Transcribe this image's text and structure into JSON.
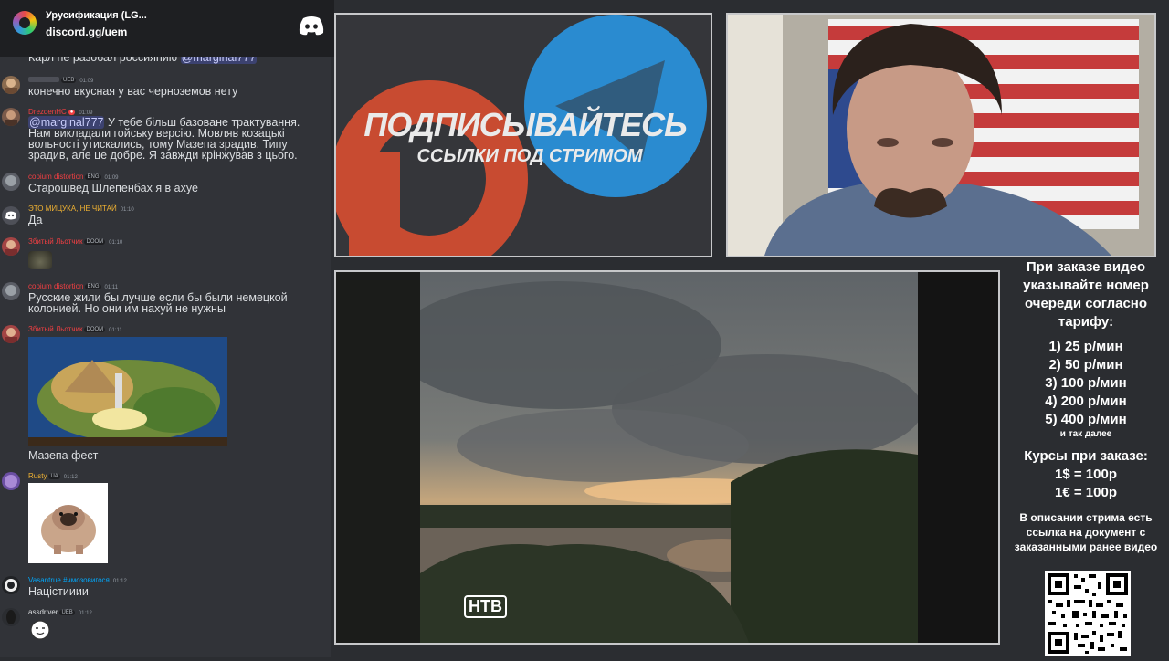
{
  "server": {
    "name": "Урусификация (LG...",
    "link": "discord.gg/uem",
    "logo_icon": "discord-icon"
  },
  "messages": [
    {
      "id": "m0",
      "username": "",
      "badges": [],
      "time": "",
      "text_parts": [
        {
          "t": "Карл не разобал россиянию "
        },
        {
          "t": "@marginal777",
          "mention": true
        }
      ],
      "name_color": "#949ba4"
    },
    {
      "id": "m1",
      "username": "",
      "badges": [
        "UEB"
      ],
      "time": "01:09",
      "text": "конечно вкусная  у вас черноземов нету",
      "name_color": "#949ba4"
    },
    {
      "id": "m2",
      "username": "DrezdenHC",
      "badges": [],
      "time": "01:09",
      "text_parts": [
        {
          "t": "@marginal777",
          "mention": true
        },
        {
          "t": " У тебе більш базоване трактування. Нам викладали гойську версію. Мовляв козацькі вольності утискались, тому Мазепа зрадив. Типу зрадив, але це добре. Я завжди крінжував з цього."
        }
      ],
      "name_color": "#f23f42"
    },
    {
      "id": "m3",
      "username": "copium distortion",
      "badges": [
        "ENG"
      ],
      "time": "01:09",
      "text": "Старошвед Шлепенбах я в ахуе",
      "name_color": "#f23f42"
    },
    {
      "id": "m4",
      "username": "ЭТО МИЦУКА, НЕ ЧИТАЙ",
      "badges": [],
      "time": "01:10",
      "text": "Да",
      "name_color": "#f0b232"
    },
    {
      "id": "m5",
      "username": "Збитый Льотчик",
      "badges": [
        "DOOM"
      ],
      "time": "01:10",
      "text": "",
      "name_color": "#f23f42"
    },
    {
      "id": "m6",
      "username": "copium distortion",
      "badges": [
        "ENG"
      ],
      "time": "01:11",
      "text": "Русские жили бы лучше если бы были немецкой колонией. Но они им нахуй не нужны",
      "name_color": "#f23f42"
    },
    {
      "id": "m7",
      "username": "Збитый Льотчик",
      "badges": [
        "DOOM"
      ],
      "time": "01:11",
      "text": "Мазепа фест",
      "name_color": "#f23f42"
    },
    {
      "id": "m8",
      "username": "Rusty",
      "badges": [
        "UA"
      ],
      "time": "01:12",
      "text": "",
      "name_color": "#f0b232"
    },
    {
      "id": "m9",
      "username": "Vasantrue #чмозовигося",
      "badges": [],
      "time": "01:12",
      "text": "Націстииии",
      "name_color": "#00a8fc"
    },
    {
      "id": "m10",
      "username": "assdriver",
      "badges": [
        "UEB"
      ],
      "time": "01:12",
      "text": "",
      "name_color": "#dbdee1"
    }
  ],
  "promo": {
    "title": "ПОДПИСЫВАЙТЕСЬ",
    "subtitle": "ССЫЛКИ ПОД СТРИМОМ",
    "icons": [
      "patreon-icon",
      "telegram-icon"
    ]
  },
  "video": {
    "channel_logo": "НТВ"
  },
  "side": {
    "heading": "При заказе видео указывайте номер очереди согласно тарифу:",
    "tariffs": [
      "1) 25 р/мин",
      "2) 50 р/мин",
      "3) 100 р/мин",
      "4) 200 р/мин",
      "5) 400 р/мин"
    ],
    "etc": "и так далее",
    "rates_title": "Курсы при заказе:",
    "rates": [
      "1$ = 100р",
      "1€ = 100р"
    ],
    "note": "В описании стрима есть ссылка на документ с заказанными ранее видео"
  }
}
